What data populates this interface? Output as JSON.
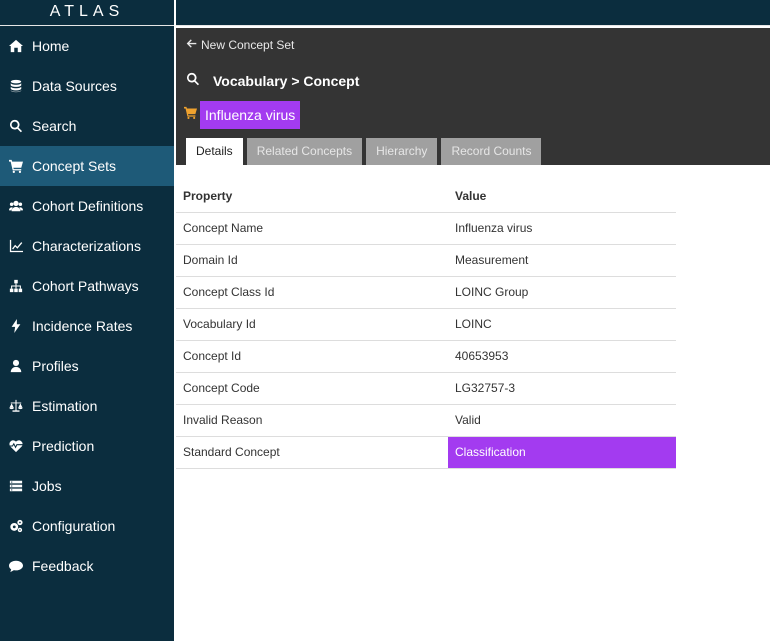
{
  "app": {
    "logo": "ATLAS"
  },
  "sidebar": {
    "items": [
      {
        "label": "Home",
        "icon": "home-icon",
        "active": false
      },
      {
        "label": "Data Sources",
        "icon": "database-icon",
        "active": false
      },
      {
        "label": "Search",
        "icon": "search-icon",
        "active": false
      },
      {
        "label": "Concept Sets",
        "icon": "cart-icon",
        "active": true
      },
      {
        "label": "Cohort Definitions",
        "icon": "users-icon",
        "active": false
      },
      {
        "label": "Characterizations",
        "icon": "line-chart-icon",
        "active": false
      },
      {
        "label": "Cohort Pathways",
        "icon": "sitemap-icon",
        "active": false
      },
      {
        "label": "Incidence Rates",
        "icon": "bolt-icon",
        "active": false
      },
      {
        "label": "Profiles",
        "icon": "user-icon",
        "active": false
      },
      {
        "label": "Estimation",
        "icon": "balance-scale-icon",
        "active": false
      },
      {
        "label": "Prediction",
        "icon": "heartbeat-icon",
        "active": false
      },
      {
        "label": "Jobs",
        "icon": "list-icon",
        "active": false
      },
      {
        "label": "Configuration",
        "icon": "cogs-icon",
        "active": false
      },
      {
        "label": "Feedback",
        "icon": "comment-icon",
        "active": false
      }
    ]
  },
  "header": {
    "back_link": "New Concept Set",
    "breadcrumb": "Vocabulary > Concept",
    "concept_name": "Influenza virus"
  },
  "tabs": [
    {
      "label": "Details",
      "active": true
    },
    {
      "label": "Related Concepts",
      "active": false
    },
    {
      "label": "Hierarchy",
      "active": false
    },
    {
      "label": "Record Counts",
      "active": false
    }
  ],
  "table": {
    "headers": [
      "Property",
      "Value"
    ],
    "rows": [
      {
        "property": "Concept Name",
        "value": "Influenza virus"
      },
      {
        "property": "Domain Id",
        "value": "Measurement"
      },
      {
        "property": "Concept Class Id",
        "value": "LOINC Group"
      },
      {
        "property": "Vocabulary Id",
        "value": "LOINC"
      },
      {
        "property": "Concept Id",
        "value": "40653953"
      },
      {
        "property": "Concept Code",
        "value": "LG32757-3"
      },
      {
        "property": "Invalid Reason",
        "value": "Valid"
      },
      {
        "property": "Standard Concept",
        "value": "Classification",
        "highlight": true
      }
    ]
  },
  "colors": {
    "sidebar_bg": "#0b2d3e",
    "active_nav": "#1e5a78",
    "header_bg": "#343434",
    "accent_purple": "#a33bf0",
    "cart_orange": "#f0a22e"
  }
}
